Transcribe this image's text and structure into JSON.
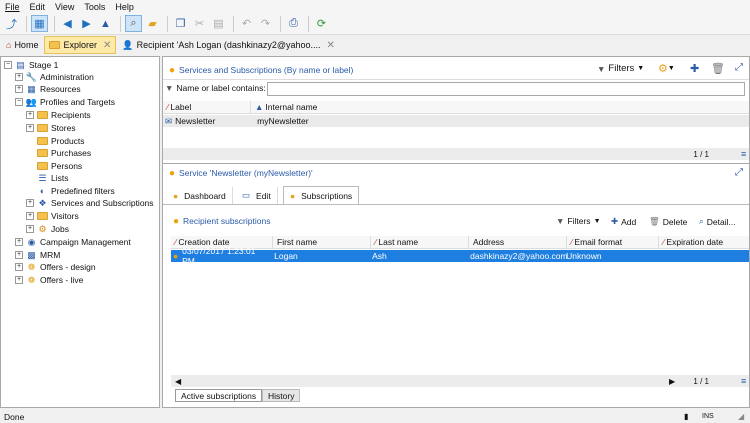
{
  "menu": [
    "File",
    "Edit",
    "View",
    "Tools",
    "Help"
  ],
  "tabs": [
    {
      "label": "Home"
    },
    {
      "label": "Explorer"
    },
    {
      "label": "Recipient 'Ash Logan (dashkinazy2@yahoo...."
    }
  ],
  "tree": [
    {
      "label": "Stage 1"
    },
    {
      "label": "Administration"
    },
    {
      "label": "Resources"
    },
    {
      "label": "Profiles and Targets"
    },
    {
      "label": "Recipients"
    },
    {
      "label": "Stores"
    },
    {
      "label": "Products"
    },
    {
      "label": "Purchases"
    },
    {
      "label": "Persons"
    },
    {
      "label": "Lists"
    },
    {
      "label": "Predefined filters"
    },
    {
      "label": "Services and Subscriptions"
    },
    {
      "label": "Visitors"
    },
    {
      "label": "Jobs"
    },
    {
      "label": "Campaign Management"
    },
    {
      "label": "MRM"
    },
    {
      "label": "Offers - design"
    },
    {
      "label": "Offers - live"
    }
  ],
  "top_panel": {
    "title": "Services and Subscriptions (By name or label)",
    "filters_label": "Filters",
    "search_label": "Name or label contains:",
    "search_value": "",
    "columns": [
      "Label",
      "Internal name"
    ],
    "row": {
      "label": "Newsletter",
      "internal": "myNewsletter"
    },
    "pager": "1 / 1"
  },
  "service_panel": {
    "title": "Service 'Newsletter (myNewsletter)'",
    "tabs": [
      "Dashboard",
      "Edit",
      "Subscriptions"
    ],
    "subs_title": "Recipient subscriptions",
    "filters_label": "Filters",
    "add_label": "Add",
    "delete_label": "Delete",
    "detail_label": "Detail...",
    "columns": [
      "Creation date",
      "First name",
      "Last name",
      "Address",
      "Email format",
      "Expiration date"
    ],
    "row": {
      "creation": "03/07/2017 1:23:01 PM",
      "first": "Logan",
      "last": "Ash",
      "address": "dashkinazy2@yahoo.com",
      "format": "Unknown",
      "expiration": ""
    },
    "pager": "1 / 1",
    "bottom_tabs": [
      "Active subscriptions",
      "History"
    ]
  },
  "status": {
    "left": "Done",
    "ins": "INS"
  }
}
